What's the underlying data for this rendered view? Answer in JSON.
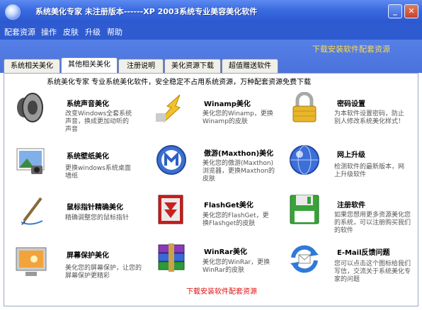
{
  "window": {
    "title": "系统美化专家  未注册版本------XP  2003系统专业美容美化软件",
    "min_icon": "minimize-icon",
    "close_icon": "close-icon",
    "min_glyph": "_",
    "close_glyph": "✕"
  },
  "menu": [
    "配套资源",
    "操作",
    "皮肤",
    "升级",
    "帮助"
  ],
  "promo_top": "下载安装软件配套资源",
  "tabs": [
    "系统相关美化",
    "其他相关美化",
    "注册说明",
    "美化资源下载",
    "超值赠送软件"
  ],
  "active_tab": "其他相关美化",
  "header": "系统美化专家   专业系统美化软件，安全稳定不占用系统资源，万种配套资源免费下载",
  "items": [
    {
      "title": "系统声音美化",
      "desc": "改变Windows全套系统声音，换成更加动听的声音",
      "icon": "speaker-icon"
    },
    {
      "title": "Winamp美化",
      "desc": "美化您的Winamp，更换Winamp的皮肤",
      "icon": "winamp-icon"
    },
    {
      "title": "密码设置",
      "desc": "为本软件设置密码，防止别人修改系统美化样式！",
      "icon": "padlock-icon"
    },
    {
      "title": "系统壁纸美化",
      "desc": "更换windows系统桌面墙纸",
      "icon": "wallpaper-icon"
    },
    {
      "title": "傲游(Maxthon)美化",
      "desc": "美化您的傲游(Maxthon)浏览器，更换Maxthon的皮肤",
      "icon": "maxthon-icon"
    },
    {
      "title": "网上升级",
      "desc": "检测软件的最新版本，网上升级软件",
      "icon": "globe-icon"
    },
    {
      "title": "鼠标指针精确美化",
      "desc": "精确调整您的鼠标指针",
      "icon": "pen-pointer-icon"
    },
    {
      "title": "FlashGet美化",
      "desc": "美化您的FlashGet，更换Flashget的皮肤",
      "icon": "flashget-icon"
    },
    {
      "title": "注册软件",
      "desc": "如果您想用更多资源美化您的系统，可以注册购买我们的软件",
      "icon": "floppy-disk-icon"
    },
    {
      "title": "屏幕保护美化",
      "desc": "美化您的屏幕保护，让您的屏幕保护更精彩",
      "icon": "monitor-icon"
    },
    {
      "title": "WinRar美化",
      "desc": "美化您的WinRar，更换WinRar的皮肤",
      "icon": "winrar-books-icon"
    },
    {
      "title": "E-Mail反馈问题",
      "desc": "您可以点击这个图标给我们写信，交流关于系统美化专家的问题",
      "icon": "email-refresh-icon"
    }
  ],
  "promo_bottom": "下载安装软件配套资源",
  "colors": {
    "title_blue": "#3a6ae0",
    "menu_blue": "#2f5bd0",
    "promo_yellow": "#ffd94a",
    "promo_red": "#e01010"
  }
}
